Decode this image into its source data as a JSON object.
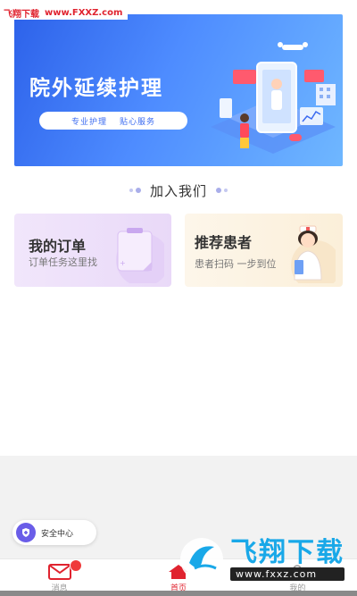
{
  "watermark_top": {
    "site_name": "飞翔下载",
    "url": "www.FXXZ.com"
  },
  "banner": {
    "title": "院外延续护理",
    "tags": [
      "专业护理",
      "贴心服务"
    ]
  },
  "section": {
    "title": "加入我们"
  },
  "cards": [
    {
      "title": "我的订单",
      "subtitle": "订单任务这里找",
      "icon": "notepad-icon"
    },
    {
      "title": "推荐患者",
      "subtitle": "患者扫码 一步到位",
      "icon": "nurse-icon"
    }
  ],
  "floating": {
    "label": "安全中心",
    "icon": "shield-icon"
  },
  "tabs": [
    {
      "label": "消息",
      "icon": "mail-icon",
      "active": false,
      "has_badge": true
    },
    {
      "label": "首页",
      "icon": "home-icon",
      "active": true
    },
    {
      "label": "我的",
      "icon": "user-icon",
      "active": false
    }
  ],
  "watermark_bottom": {
    "title": "飞翔下载",
    "url": "www.fxxz.com"
  },
  "colors": {
    "accent": "#e0232f",
    "banner_blue": "#3b6bf0",
    "safety_purple": "#6a5de8",
    "watermark_blue": "#19a8e8"
  }
}
